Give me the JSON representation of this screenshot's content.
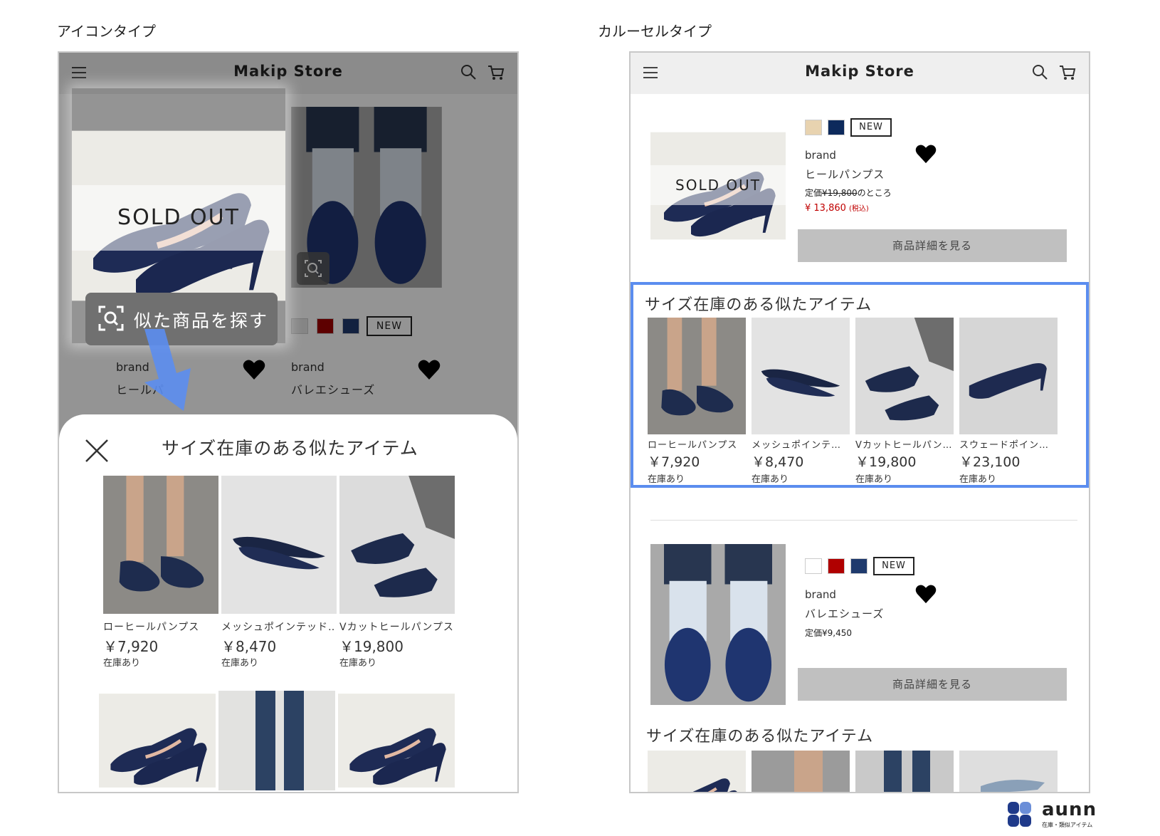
{
  "left": {
    "caption": "アイコンタイプ",
    "store_title": "Makip Store",
    "sold_out": "SOLD OUT",
    "find_button": "似た商品を探す",
    "new_badge": "NEW",
    "products": [
      {
        "brand": "brand",
        "name": "ヒールパ"
      },
      {
        "brand": "brand",
        "name": "バレエシューズ"
      }
    ],
    "swatches": [
      "#e6e6e6",
      "#a00000",
      "#1f3a6d"
    ],
    "sheet_title": "サイズ在庫のある似たアイテム",
    "items": [
      {
        "name": "ローヒールパンプス",
        "price": "￥7,920",
        "stock": "在庫あり"
      },
      {
        "name": "メッシュポインテッド…",
        "price": "￥8,470",
        "stock": "在庫あり"
      },
      {
        "name": "Vカットヒールパンプス",
        "price": "￥19,800",
        "stock": "在庫あり"
      }
    ]
  },
  "right": {
    "caption": "カルーセルタイプ",
    "store_title": "Makip Store",
    "product1": {
      "sold_out": "SOLD OUT",
      "new_badge": "NEW",
      "brand": "brand",
      "name": "ヒールパンプス",
      "list_price_prefix": "定価",
      "list_price": "¥19,800",
      "list_price_suffix": "のところ",
      "sale_price": "¥ 13,860",
      "tax_note": "(税込)",
      "detail_button": "商品詳細を見る",
      "swatches": [
        "#e8d3b0",
        "#0d2a5c"
      ]
    },
    "section_title": "サイズ在庫のある似たアイテム",
    "carousel": [
      {
        "name": "ローヒールパンプス",
        "price": "￥7,920",
        "stock": "在庫あり"
      },
      {
        "name": "メッシュポインテ…",
        "price": "￥8,470",
        "stock": "在庫あり"
      },
      {
        "name": "Vカットヒールパン…",
        "price": "￥19,800",
        "stock": "在庫あり"
      },
      {
        "name": "スウェードポイン…",
        "price": "￥23,100",
        "stock": "在庫あり"
      }
    ],
    "product2": {
      "new_badge": "NEW",
      "brand": "brand",
      "name": "バレエシューズ",
      "list_price": "定価¥9,450",
      "detail_button": "商品詳細を見る",
      "swatches": [
        "#ffffff",
        "#b00000",
        "#1f3a6d"
      ]
    },
    "section_title_2": "サイズ在庫のある似たアイテム"
  },
  "logo": {
    "word": "aunn",
    "sub": "在庫・類似アイテム"
  },
  "colors": {
    "highlight": "#5b8def",
    "sale_red": "#c00000",
    "arrow": "#5b8def"
  }
}
